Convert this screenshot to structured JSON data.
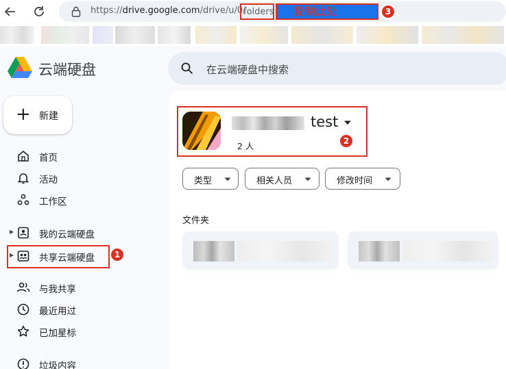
{
  "browser": {
    "url_scheme": "https://",
    "url_host": "drive.google.com",
    "url_path": "/drive/u/0/",
    "url_highlight": "folders",
    "selection_note": "复制此处",
    "callouts": [
      "1",
      "2",
      "3"
    ]
  },
  "app": {
    "title": "云端硬盘",
    "new_button": "新建",
    "search_placeholder": "在云端硬盘中搜索"
  },
  "sidebar": {
    "items": [
      {
        "label": "首页",
        "icon": "home-icon"
      },
      {
        "label": "活动",
        "icon": "bell-icon"
      },
      {
        "label": "工作区",
        "icon": "workspaces-icon"
      },
      {
        "label": "我的云端硬盘",
        "icon": "my-drive-icon"
      },
      {
        "label": "共享云端硬盘",
        "icon": "shared-drives-icon"
      },
      {
        "label": "与我共享",
        "icon": "people-icon"
      },
      {
        "label": "最近用过",
        "icon": "clock-icon"
      },
      {
        "label": "已加星标",
        "icon": "star-icon"
      },
      {
        "label": "垃圾内容",
        "icon": "info-icon"
      }
    ]
  },
  "drive": {
    "name": "test",
    "members": "2 人"
  },
  "filters": [
    "类型",
    "相关人员",
    "修改时间"
  ],
  "sections": {
    "folders": "文件夹"
  },
  "colors": {
    "accent": "#1a73e8",
    "annotation": "#d93025",
    "sidebar_bg": "#f8fafd",
    "search_bg": "#e9eef6"
  }
}
